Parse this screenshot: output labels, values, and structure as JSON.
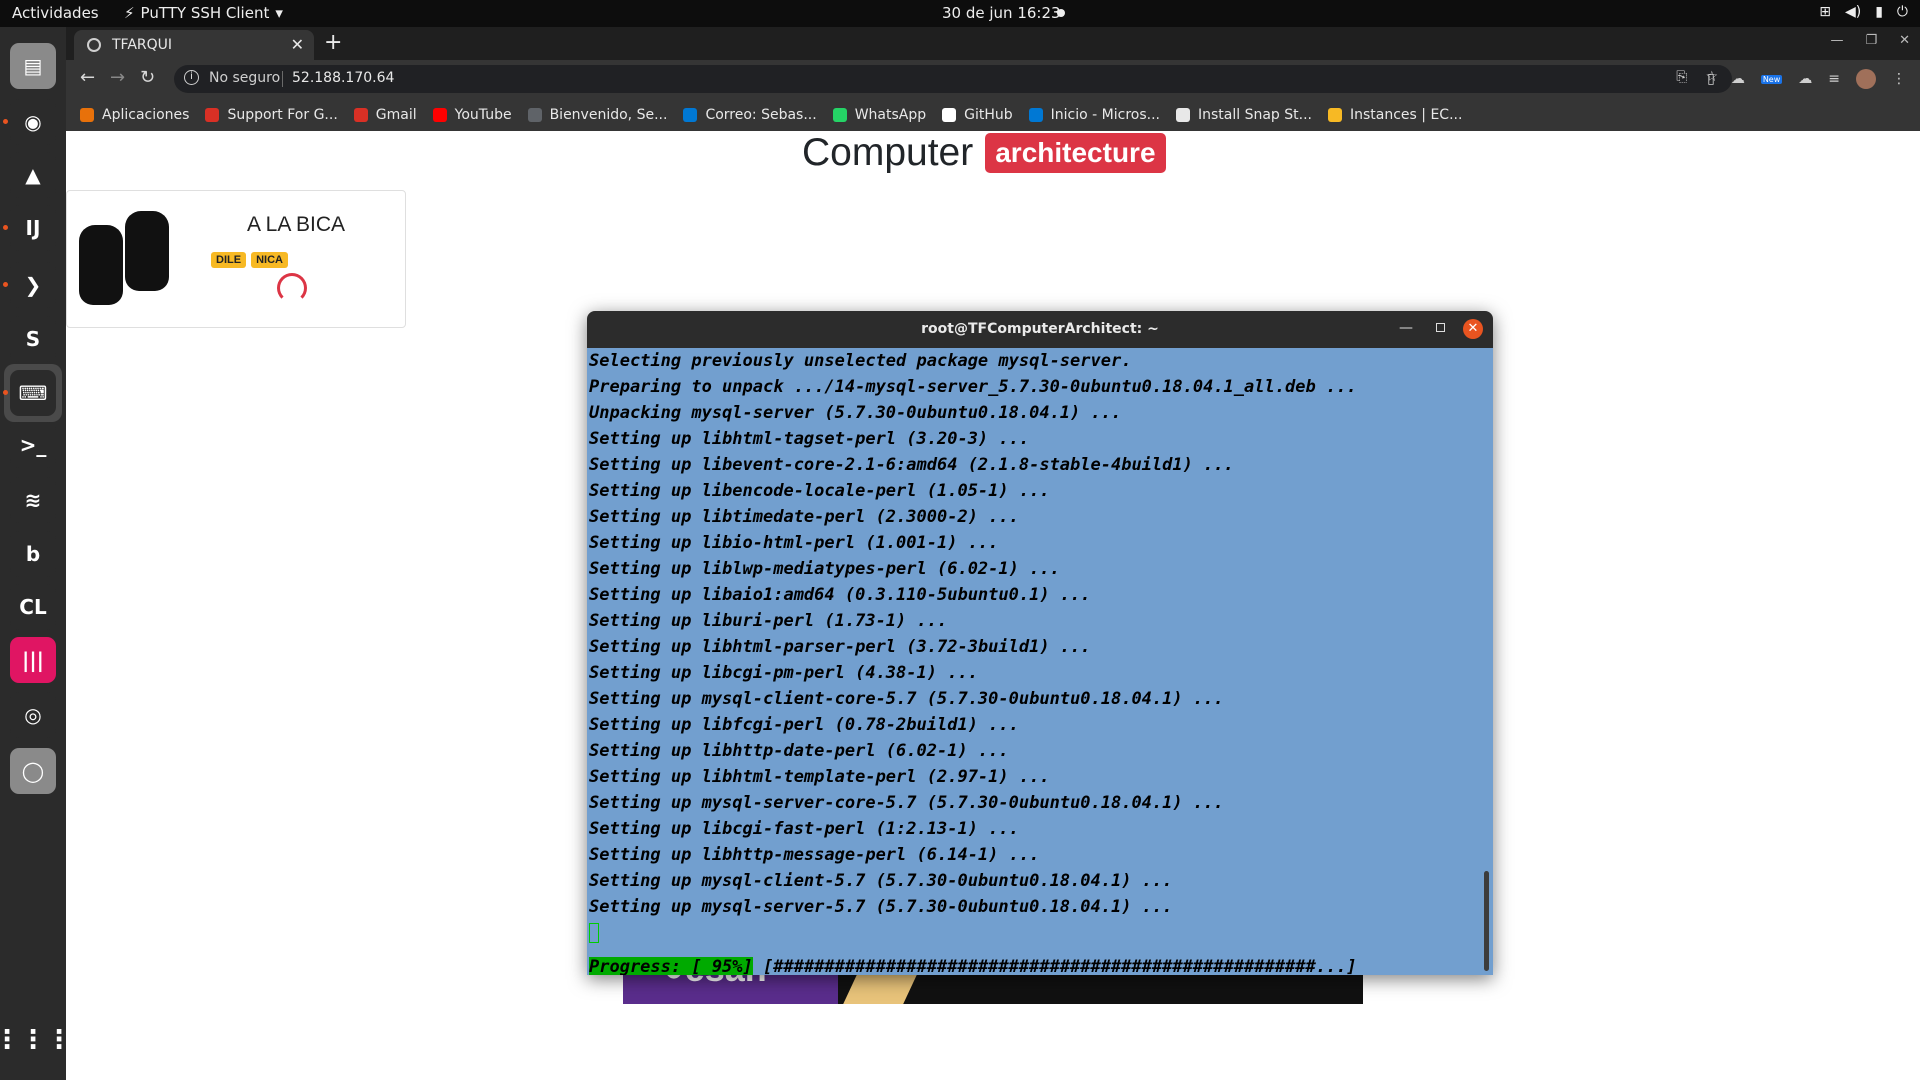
{
  "topbar": {
    "activities": "Actividades",
    "app_menu": "PuTTY SSH Client",
    "clock": "30 de jun  16:23"
  },
  "browser": {
    "tab_title": "TFARQUI",
    "security_label": "No seguro",
    "url": "52.188.170.64",
    "new_badge": "New",
    "bookmarks": [
      {
        "label": "Aplicaciones",
        "color": "#e8710a"
      },
      {
        "label": "Support For G...",
        "color": "#d93025"
      },
      {
        "label": "Gmail",
        "color": "#d93025"
      },
      {
        "label": "YouTube",
        "color": "#ff0000"
      },
      {
        "label": "Bienvenido, Se...",
        "color": "#5f6368"
      },
      {
        "label": "Correo: Sebas...",
        "color": "#0078d4"
      },
      {
        "label": "WhatsApp",
        "color": "#25d366"
      },
      {
        "label": "GitHub",
        "color": "#ffffff"
      },
      {
        "label": "Inicio - Micros...",
        "color": "#0078d4"
      },
      {
        "label": "Install Snap St...",
        "color": "#e8e8e8"
      },
      {
        "label": "Instances | EC...",
        "color": "#f7b924"
      }
    ]
  },
  "page": {
    "heading": "Computer",
    "heading_badge": "architecture",
    "card_title": "A LA BICA",
    "card_tags": [
      "DILE",
      "NICA"
    ]
  },
  "terminal": {
    "title": "root@TFComputerArchitect: ~",
    "lines": [
      "Selecting previously unselected package mysql-server.",
      "Preparing to unpack .../14-mysql-server_5.7.30-0ubuntu0.18.04.1_all.deb ...",
      "Unpacking mysql-server (5.7.30-0ubuntu0.18.04.1) ...",
      "Setting up libhtml-tagset-perl (3.20-3) ...",
      "Setting up libevent-core-2.1-6:amd64 (2.1.8-stable-4build1) ...",
      "Setting up libencode-locale-perl (1.05-1) ...",
      "Setting up libtimedate-perl (2.3000-2) ...",
      "Setting up libio-html-perl (1.001-1) ...",
      "Setting up liblwp-mediatypes-perl (6.02-1) ...",
      "Setting up libaio1:amd64 (0.3.110-5ubuntu0.1) ...",
      "Setting up liburi-perl (1.73-1) ...",
      "Setting up libhtml-parser-perl (3.72-3build1) ...",
      "Setting up libcgi-pm-perl (4.38-1) ...",
      "Setting up mysql-client-core-5.7 (5.7.30-0ubuntu0.18.04.1) ...",
      "Setting up libfcgi-perl (0.78-2build1) ...",
      "Setting up libhttp-date-perl (6.02-1) ...",
      "Setting up libhtml-template-perl (2.97-1) ...",
      "Setting up mysql-server-core-5.7 (5.7.30-0ubuntu0.18.04.1) ...",
      "Setting up libcgi-fast-perl (1:2.13-1) ...",
      "Setting up libhttp-message-perl (6.14-1) ...",
      "Setting up mysql-client-5.7 (5.7.30-0ubuntu0.18.04.1) ...",
      "Setting up mysql-server-5.7 (5.7.30-0ubuntu0.18.04.1) ..."
    ],
    "progress_label": "Progress: [ 95%]",
    "progress_bar": "[#####################################################...]",
    "progress_percent": 95
  },
  "dock": [
    {
      "name": "files-icon",
      "bg": "#8a8a8a",
      "glyph": "▤"
    },
    {
      "name": "chrome-icon",
      "bg": "#2b2b2b",
      "glyph": "◉"
    },
    {
      "name": "android-studio-icon",
      "bg": "#2b2b2b",
      "glyph": "▲"
    },
    {
      "name": "intellij-icon",
      "bg": "#2b2b2b",
      "glyph": "IJ"
    },
    {
      "name": "vscode-icon",
      "bg": "#2b2b2b",
      "glyph": "❯"
    },
    {
      "name": "sublime-icon",
      "bg": "#2b2b2b",
      "glyph": "S"
    },
    {
      "name": "putty-icon",
      "bg": "#2b2b2b",
      "glyph": "⌨"
    },
    {
      "name": "terminal-icon",
      "bg": "#2b2b2b",
      "glyph": ">_"
    },
    {
      "name": "spotify-icon",
      "bg": "#2b2b2b",
      "glyph": "≋"
    },
    {
      "name": "bitwarden-icon",
      "bg": "#2b2b2b",
      "glyph": "b"
    },
    {
      "name": "clion-icon",
      "bg": "#2b2b2b",
      "glyph": "CL"
    },
    {
      "name": "audio-app-icon",
      "bg": "#e01563",
      "glyph": "|||"
    },
    {
      "name": "obs-icon",
      "bg": "#2b2b2b",
      "glyph": "◎"
    },
    {
      "name": "disk-icon",
      "bg": "#8a8a8a",
      "glyph": "◯"
    }
  ]
}
